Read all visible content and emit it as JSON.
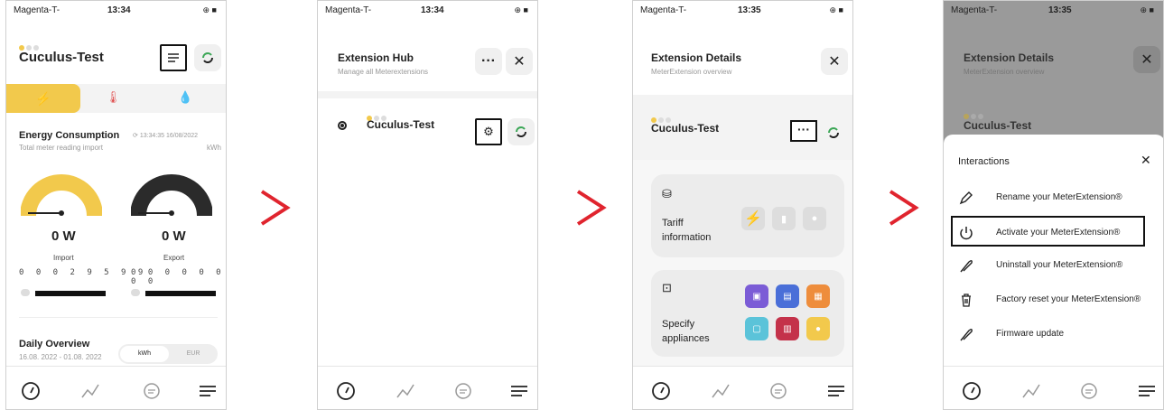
{
  "statusbar": {
    "carrier": "Magenta-T-",
    "battery": "⊕ ■"
  },
  "screen1": {
    "time": "13:34",
    "title": "Cuculus-Test",
    "section_title": "Energy Consumption",
    "section_subtitle": "Total meter reading import",
    "timestamp": "13:34:35 16/08/2022",
    "unit": "kWh",
    "import_value": "0 W",
    "export_value": "0 W",
    "import_label": "Import",
    "export_label": "Export",
    "import_digits": "0 0 0 2 9 5 9 9",
    "export_digits": "0 0 0 0 0 0 0 0",
    "daily_title": "Daily Overview",
    "daily_range": "16.08. 2022 - 01.08. 2022",
    "toggle_kwh": "kWh",
    "toggle_eur": "EUR"
  },
  "screen2": {
    "time": "13:34",
    "title": "Extension Hub",
    "subtitle": "Manage all Meterextensions",
    "more": "···",
    "close": "✕",
    "item_name": "Cuculus-Test"
  },
  "screen3": {
    "time": "13:35",
    "title": "Extension Details",
    "subtitle": "MeterExtension overview",
    "close": "✕",
    "device_name": "Cuculus-Test",
    "more": "···",
    "tariff_label_1": "Tariff",
    "tariff_label_2": "information",
    "appliances_label_1": "Specify",
    "appliances_label_2": "appliances"
  },
  "screen4": {
    "time": "13:35",
    "title": "Extension Details",
    "subtitle": "MeterExtension overview",
    "device_name": "Cuculus-Test",
    "sheet_title": "Interactions",
    "close": "✕",
    "items": [
      {
        "label": "Rename your MeterExtension®",
        "icon": "pencil-icon"
      },
      {
        "label": "Activate your MeterExtension®",
        "icon": "power-icon"
      },
      {
        "label": "Uninstall your MeterExtension®",
        "icon": "feather-icon"
      },
      {
        "label": "Factory reset your MeterExtension®",
        "icon": "trash-icon"
      },
      {
        "label": "Firmware update",
        "icon": "feather-icon"
      }
    ]
  },
  "colors": {
    "accent_yellow": "#f2c94c",
    "arrow_red": "#e0242e",
    "highlight_border": "#111111",
    "refresh_green": "#3aa655"
  }
}
